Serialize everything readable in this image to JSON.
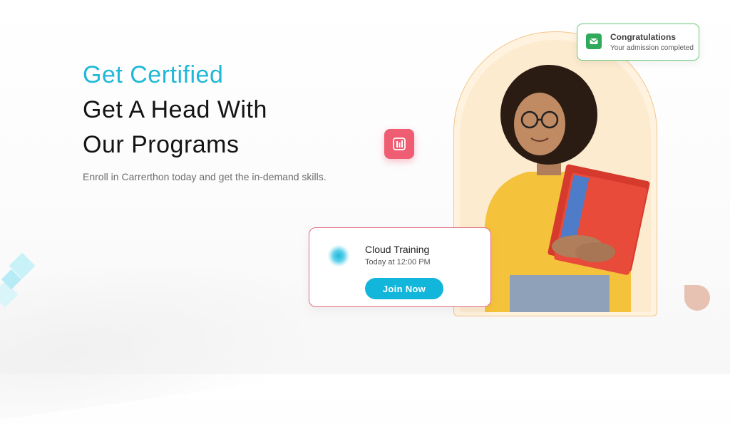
{
  "hero": {
    "accent_title": "Get Certified",
    "title_line1": "Get A Head With",
    "title_line2": "Our Programs",
    "subtitle": "Enroll in Carrerthon today and get the in-demand skills."
  },
  "notification": {
    "title": "Congratulations",
    "subtitle": "Your admission completed",
    "icon": "mail-icon"
  },
  "class_card": {
    "title": "Cloud Training",
    "time": "Today at 12:00 PM",
    "button_label": "Join Now"
  },
  "colors": {
    "accent": "#1fb8d8",
    "button": "#13b6db",
    "badge": "#ef5d73",
    "success": "#2eaa5a",
    "arch_border": "#f3c58a"
  },
  "icons": {
    "chart_badge": "bar-chart-icon"
  }
}
